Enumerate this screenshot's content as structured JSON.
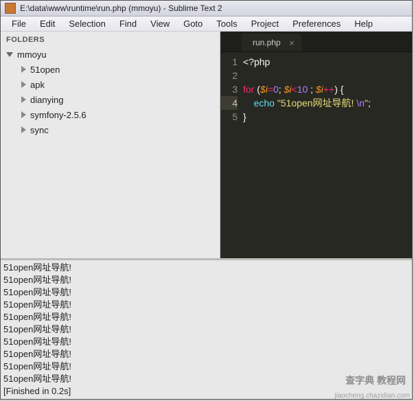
{
  "window": {
    "title": "E:\\data\\www\\runtime\\run.php (mmoyu) - Sublime Text 2"
  },
  "menu": {
    "items": [
      "File",
      "Edit",
      "Selection",
      "Find",
      "View",
      "Goto",
      "Tools",
      "Project",
      "Preferences",
      "Help"
    ]
  },
  "sidebar": {
    "header": "FOLDERS",
    "root": "mmoyu",
    "children": [
      "51open",
      "apk",
      "dianying",
      "symfony-2.5.6",
      "sync"
    ]
  },
  "tab": {
    "name": "run.php"
  },
  "code": {
    "line1": "<?php",
    "line2": "",
    "line3": {
      "for": "for",
      "lp": " (",
      "v1": "$i",
      "eq": "=",
      "n0": "0",
      "sc1": "; ",
      "v2": "$i",
      "lt": "<",
      "n10": "10",
      "sc2": " ; ",
      "v3": "$i",
      "inc": "++",
      "rp": ") {"
    },
    "line4": {
      "pad": "    ",
      "echo": "echo",
      "sp": " ",
      "q1": "\"",
      "s": "51open网址导航! ",
      "esc": "\\n",
      "q2": "\"",
      "end": ";"
    },
    "line5": "}"
  },
  "gutter": [
    "1",
    "2",
    "3",
    "4",
    "5"
  ],
  "console": {
    "lines": [
      "51open网址导航!",
      "51open网址导航!",
      "51open网址导航!",
      "51open网址导航!",
      "51open网址导航!",
      "51open网址导航!",
      "51open网址导航!",
      "51open网址导航!",
      "51open网址导航!",
      "51open网址导航!",
      "[Finished in 0.2s]"
    ]
  },
  "watermark": {
    "main": "查字典  教程网",
    "sub": "jiaocheng.chazidian.com"
  }
}
